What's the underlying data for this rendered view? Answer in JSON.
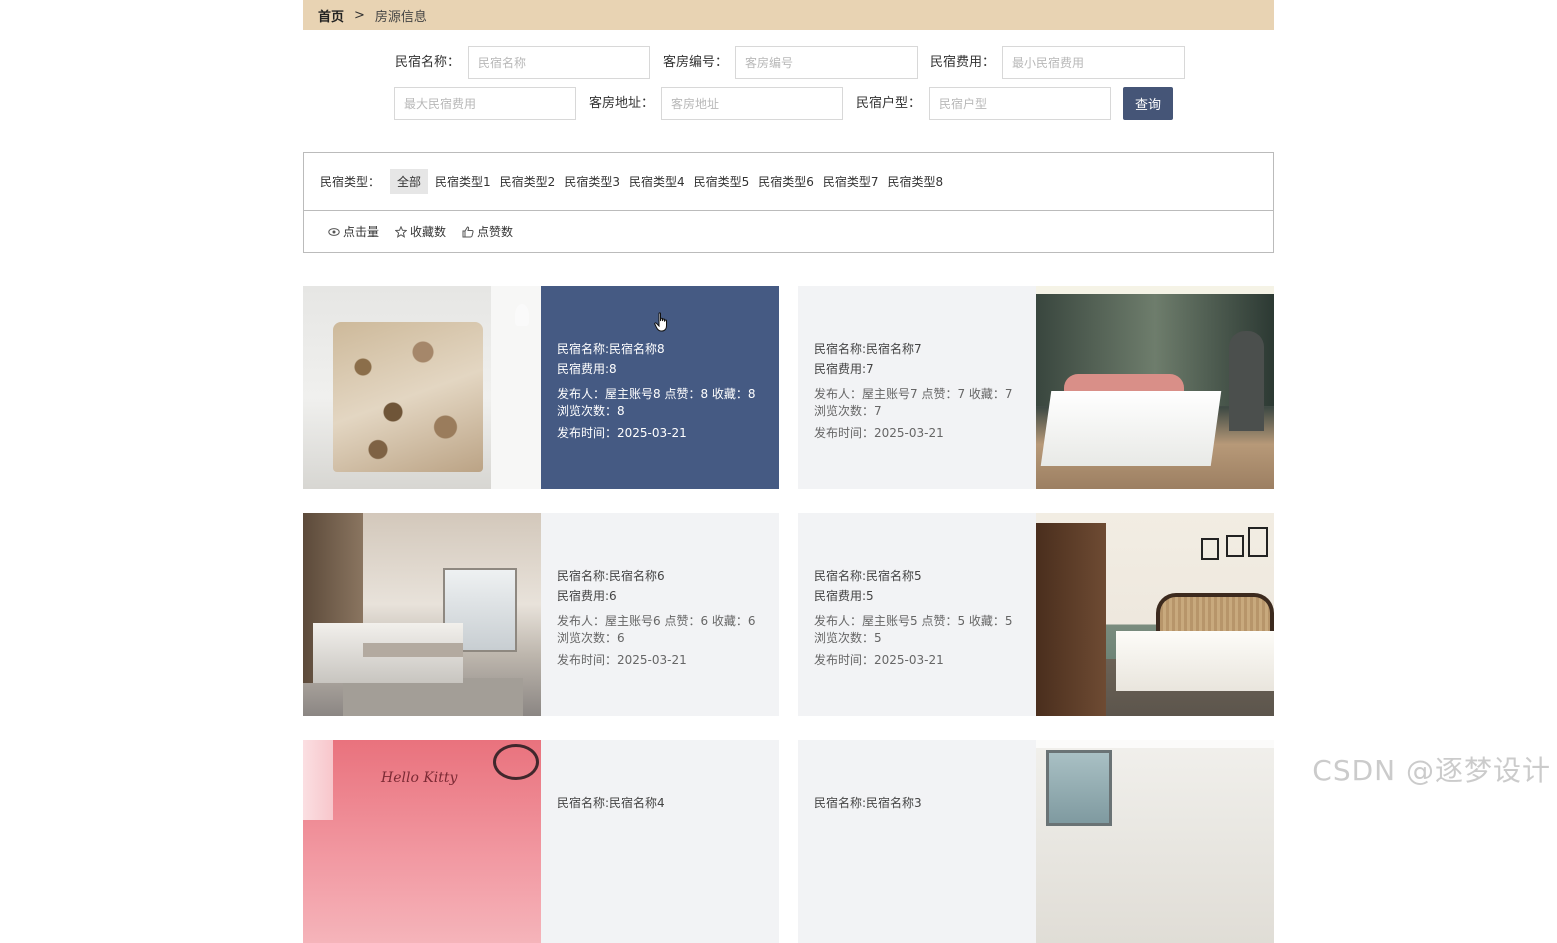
{
  "breadcrumb": {
    "home": "首页",
    "separator": ">",
    "current": "房源信息"
  },
  "search": {
    "name_label": "民宿名称：",
    "name_placeholder": "民宿名称",
    "room_no_label": "客房编号：",
    "room_no_placeholder": "客房编号",
    "fee_label": "民宿费用：",
    "min_fee_placeholder": "最小民宿费用",
    "max_fee_placeholder": "最大民宿费用",
    "address_label": "客房地址：",
    "address_placeholder": "客房地址",
    "layout_label": "民宿户型：",
    "layout_placeholder": "民宿户型",
    "query_button": "查询"
  },
  "filters": {
    "type_label": "民宿类型：",
    "types": [
      "全部",
      "民宿类型1",
      "民宿类型2",
      "民宿类型3",
      "民宿类型4",
      "民宿类型5",
      "民宿类型6",
      "民宿类型7",
      "民宿类型8"
    ],
    "active_type": "全部",
    "sorts": [
      {
        "label": "点击量",
        "icon": "eye-icon"
      },
      {
        "label": "收藏数",
        "icon": "star-icon"
      },
      {
        "label": "点赞数",
        "icon": "thumbs-up-icon"
      }
    ]
  },
  "cards": [
    {
      "name": "民宿名称:民宿名称8",
      "fee": "民宿费用:8",
      "stats": "发布人：屋主账号8   点赞：8   收藏：8",
      "views": "浏览次数：8",
      "time": "发布时间：2025-03-21"
    },
    {
      "name": "民宿名称:民宿名称7",
      "fee": "民宿费用:7",
      "stats": "发布人：屋主账号7   点赞：7   收藏：7",
      "views": "浏览次数：7",
      "time": "发布时间：2025-03-21"
    },
    {
      "name": "民宿名称:民宿名称6",
      "fee": "民宿费用:6",
      "stats": "发布人：屋主账号6   点赞：6   收藏：6",
      "views": "浏览次数：6",
      "time": "发布时间：2025-03-21"
    },
    {
      "name": "民宿名称:民宿名称5",
      "fee": "民宿费用:5",
      "stats": "发布人：屋主账号5   点赞：5   收藏：5",
      "views": "浏览次数：5",
      "time": "发布时间：2025-03-21"
    },
    {
      "name": "民宿名称:民宿名称4"
    },
    {
      "name": "民宿名称:民宿名称3"
    }
  ],
  "image_texts": {
    "pink_room": "Hello Kitty"
  },
  "colors": {
    "breadcrumb_bg": "#e8d3b3",
    "accent": "#455a83",
    "button": "#455577",
    "card_bg": "#f2f3f5"
  },
  "watermark": "CSDN @逐梦设计"
}
